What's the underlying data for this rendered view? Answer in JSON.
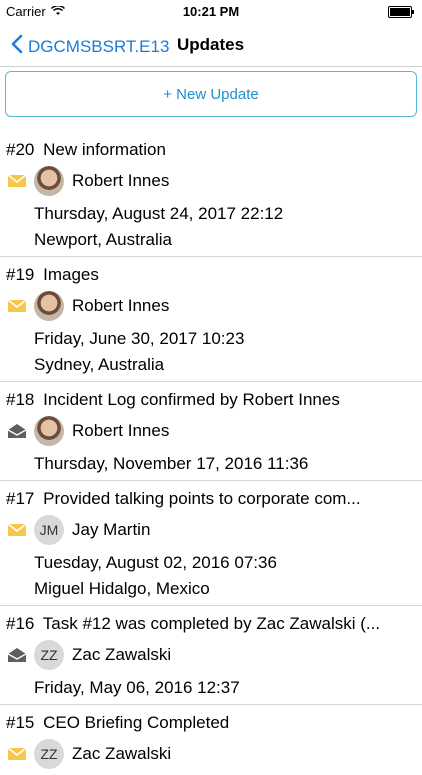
{
  "status": {
    "carrier": "Carrier",
    "time": "10:21 PM"
  },
  "nav": {
    "back_label": "DGCMSBSRT.E13",
    "title": "Updates"
  },
  "new_update_label": "+ New Update",
  "updates": [
    {
      "num": "#20",
      "title": "New information",
      "author": "Robert Innes",
      "initials": "",
      "date": "Thursday, August 24, 2017 22:12",
      "location": "Newport, Australia",
      "icon": "envelope-yellow"
    },
    {
      "num": "#19",
      "title": "Images",
      "author": "Robert Innes",
      "initials": "",
      "date": "Friday, June 30, 2017 10:23",
      "location": "Sydney, Australia",
      "icon": "envelope-yellow"
    },
    {
      "num": "#18",
      "title": "Incident Log confirmed by Robert Innes",
      "author": "Robert Innes",
      "initials": "",
      "date": "Thursday, November 17, 2016 11:36",
      "location": "",
      "icon": "envelope-open-dark"
    },
    {
      "num": "#17",
      "title": "Provided talking points to corporate com...",
      "author": "Jay Martin",
      "initials": "JM",
      "date": "Tuesday, August 02, 2016 07:36",
      "location": "Miguel Hidalgo, Mexico",
      "icon": "envelope-yellow"
    },
    {
      "num": "#16",
      "title": "Task #12 was completed by Zac Zawalski (...",
      "author": "Zac Zawalski",
      "initials": "ZZ",
      "date": "Friday, May 06, 2016 12:37",
      "location": "",
      "icon": "envelope-open-dark"
    },
    {
      "num": "#15",
      "title": "CEO Briefing Completed",
      "author": "Zac Zawalski",
      "initials": "ZZ",
      "date": "",
      "location": "",
      "icon": "envelope-yellow"
    }
  ]
}
